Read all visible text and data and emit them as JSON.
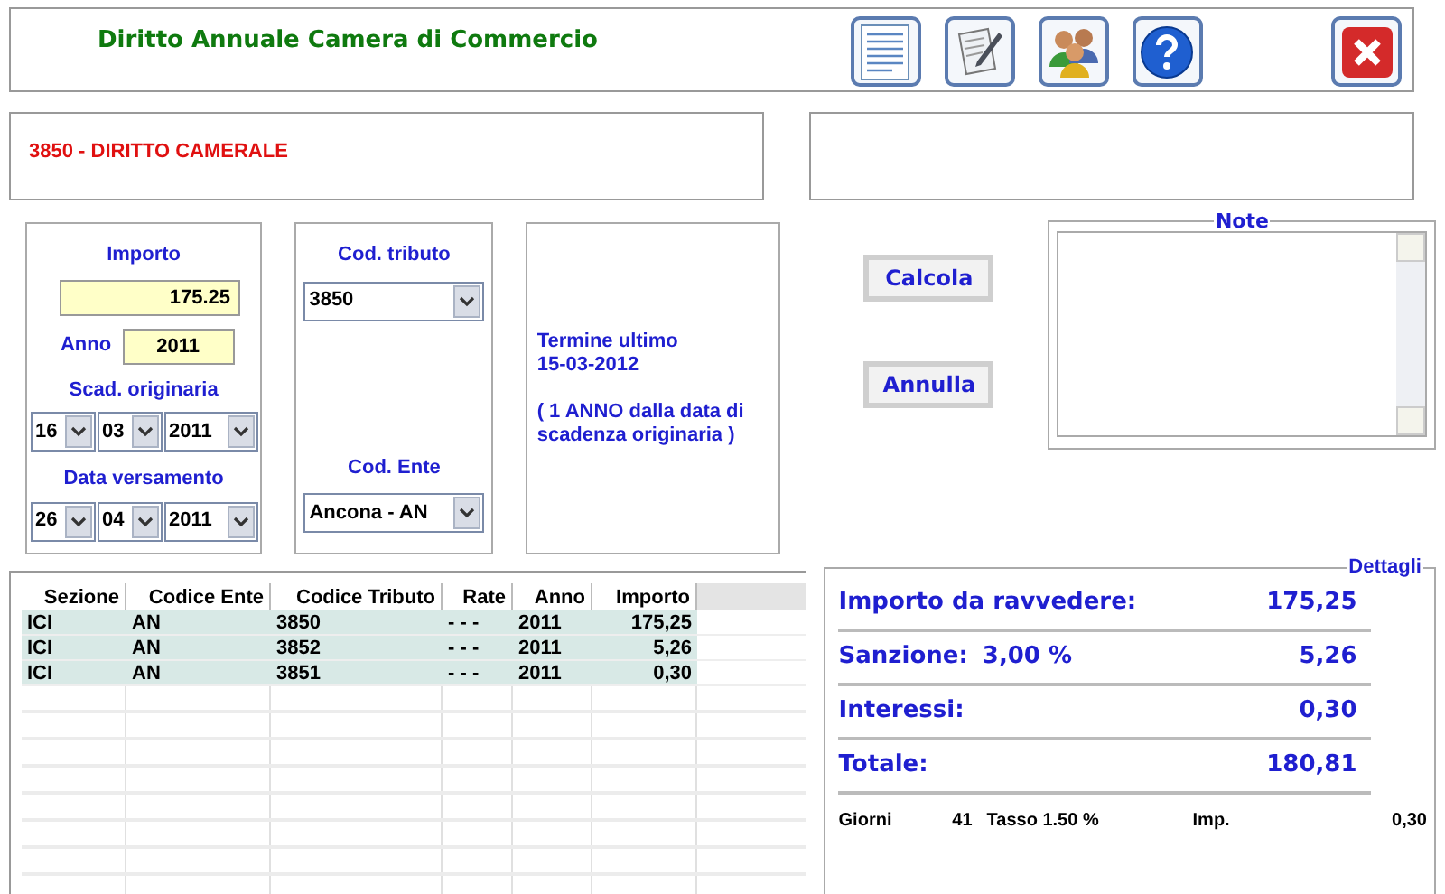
{
  "header": {
    "title": "Diritto Annuale Camera di Commercio"
  },
  "code_description": "3850 - DIRITTO CAMERALE",
  "importo": {
    "label": "Importo",
    "value": "175.25"
  },
  "anno": {
    "label": "Anno",
    "value": "2011"
  },
  "scad_originaria": {
    "label": "Scad. originaria",
    "day": "16",
    "month": "03",
    "year": "2011"
  },
  "data_versamento": {
    "label": "Data versamento",
    "day": "26",
    "month": "04",
    "year": "2011"
  },
  "cod_tributo": {
    "label": "Cod. tributo",
    "value": "3850"
  },
  "cod_ente": {
    "label": "Cod. Ente",
    "value": "Ancona - AN"
  },
  "deadline": {
    "title": "Termine ultimo",
    "date": "15-03-2012",
    "note": "( 1 ANNO dalla data di scadenza originaria )"
  },
  "buttons": [
    "Calcola",
    "Annulla"
  ],
  "note": {
    "legend": "Note"
  },
  "table": {
    "columns": [
      "Sezione",
      "Codice Ente",
      "Codice Tributo",
      "Rate",
      "Anno",
      "Importo"
    ],
    "rows": [
      [
        "ICI",
        "AN",
        "3850",
        "- - -",
        "2011",
        "175,25"
      ],
      [
        "ICI",
        "AN",
        "3852",
        "- - -",
        "2011",
        "5,26"
      ],
      [
        "ICI",
        "AN",
        "3851",
        "- - -",
        "2011",
        "0,30"
      ]
    ]
  },
  "details": {
    "legend": "Dettagli",
    "rows": [
      {
        "label": "Importo da ravvedere:",
        "value": "175,25"
      },
      {
        "label": "Sanzione:",
        "rate": "3,00 %",
        "value": "5,26"
      },
      {
        "label": "Interessi:",
        "value": "0,30"
      },
      {
        "label": "Totale:",
        "value": "180,81"
      }
    ],
    "footer": {
      "days_label": "Giorni",
      "days": "41",
      "rate": "Tasso 1.50 %",
      "imp_label": "Imp.",
      "imp": "0,30"
    }
  }
}
